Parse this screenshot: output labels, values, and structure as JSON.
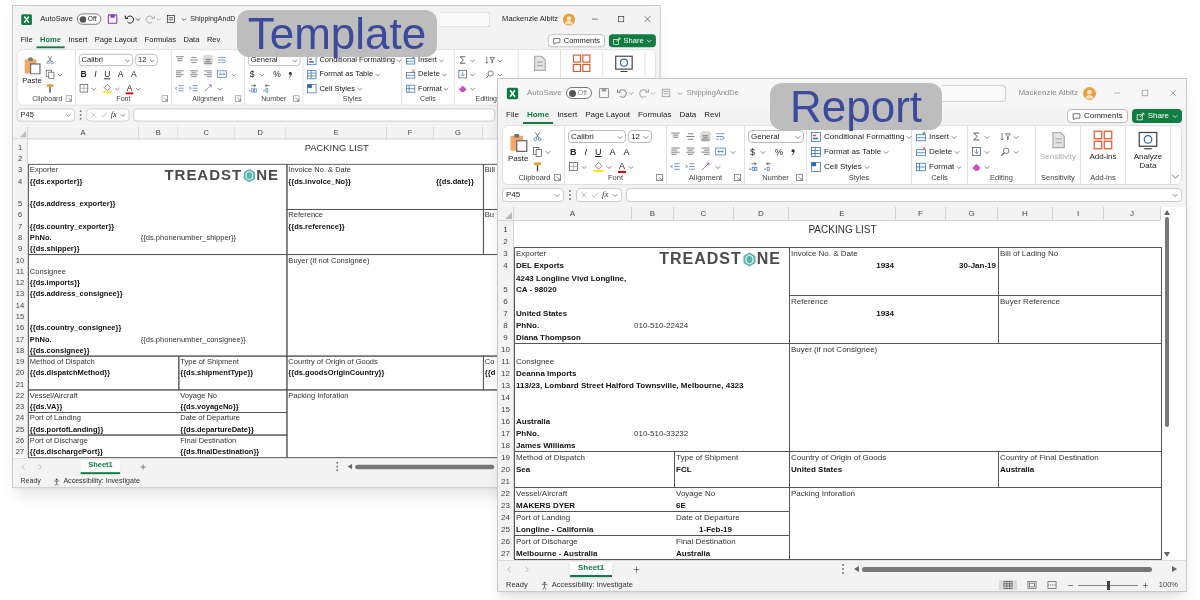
{
  "windows": [
    {
      "badge": "Template",
      "active": true,
      "title_bar": {
        "autosave": {
          "label": "AutoSave",
          "on": false,
          "state": "Off"
        },
        "filename": "ShippingAndD",
        "user": "Mackenzie Albitz"
      },
      "menu": [
        {
          "label": "File",
          "selected": false
        },
        {
          "label": "Home",
          "selected": true
        },
        {
          "label": "Insert",
          "selected": false
        },
        {
          "label": "Page Layout",
          "selected": false
        },
        {
          "label": "Formulas",
          "selected": false
        },
        {
          "label": "Data",
          "selected": false
        },
        {
          "label": "Rev",
          "selected": false
        }
      ],
      "comments": "Comments",
      "share": "Share",
      "ribbon": {
        "paste": "Paste",
        "font": "Calibri",
        "size": "12",
        "font_glyphs": [
          "B",
          "I",
          "U",
          "A",
          "A"
        ],
        "font_color": "A",
        "number_format": "General",
        "number_glyphs": [
          "$",
          "%"
        ],
        "styles": [
          "Conditional Formatting",
          "Format as Table",
          "Cell Styles"
        ],
        "cells": [
          "Insert",
          "Delete",
          "Format"
        ],
        "groups": [
          "Clipboard",
          "Font",
          "Alignment",
          "Number",
          "Styles",
          "Cells",
          "Editing"
        ],
        "extra": [
          {
            "kind": "sensitivity",
            "disabled": true
          },
          {
            "kind": "addins"
          },
          {
            "kind": "analyze"
          }
        ]
      },
      "name_box": "P45",
      "fx": "fx",
      "columns": [
        "A",
        "B",
        "C",
        "D",
        "E",
        "F",
        "G"
      ],
      "sheet": [
        {
          "row": "1",
          "cells": {
            "E": {
              "text": "PACKING LIST",
              "centered": true
            }
          }
        },
        {
          "row": "2"
        },
        {
          "row": "3",
          "logo": {
            "parts": [
              "TREADST",
              "NE"
            ]
          },
          "cells": {
            "A": {
              "text": "Exporter"
            },
            "E": {
              "text": "Invoice No. & Date"
            },
            "H": {
              "text": "Bill"
            }
          }
        },
        {
          "row": "4",
          "cells": {
            "A": {
              "text": "{{ds.exporter}}",
              "bold": true
            },
            "E": {
              "text": "{{ds.invoice_No}}",
              "bold": true
            },
            "G": {
              "text": "{{ds.date}}",
              "bold": true
            }
          }
        },
        {
          "row": "5",
          "cells": {
            "A": {
              "text": "{{ds.address_exporter}}",
              "bold": true
            }
          }
        },
        {
          "row": "6",
          "cells": {
            "E": {
              "text": "Reference"
            },
            "H": {
              "text": "Bu"
            }
          }
        },
        {
          "row": "7",
          "cells": {
            "A": {
              "text": "{{ds.country_exporter}}",
              "bold": true
            },
            "E": {
              "text": "{{ds.reference}}",
              "bold": true
            }
          }
        },
        {
          "row": "8",
          "cells": {
            "A": {
              "text": "PhNo.",
              "bold": true
            },
            "B": {
              "text": "{{ds.phonenumber_shipper}}"
            }
          }
        },
        {
          "row": "9",
          "cells": {
            "A": {
              "text": "{{ds.shipper}}",
              "bold": true
            }
          }
        },
        {
          "row": "10",
          "cells": {
            "E": {
              "text": "Buyer (if not Consignee)"
            }
          }
        },
        {
          "row": "11",
          "cells": {
            "A": {
              "text": "Consignee"
            }
          }
        },
        {
          "row": "12",
          "cells": {
            "A": {
              "text": "{{ds.imports}}",
              "bold": true
            }
          }
        },
        {
          "row": "13",
          "cells": {
            "A": {
              "text": "{{ds.address_consignee}}",
              "bold": true
            }
          }
        },
        {
          "row": "14"
        },
        {
          "row": "15"
        },
        {
          "row": "16",
          "cells": {
            "A": {
              "text": "{{ds.country_consignee}}",
              "bold": true
            }
          }
        },
        {
          "row": "17",
          "cells": {
            "A": {
              "text": "PhNo.",
              "bold": true
            },
            "B": {
              "text": "{{ds.phonenumber_consignee}}"
            }
          }
        },
        {
          "row": "18",
          "cells": {
            "A": {
              "text": "{{ds.consignee}}",
              "bold": true
            }
          }
        },
        {
          "row": "19",
          "cells": {
            "A": {
              "text": "Method of Dispatch"
            },
            "C": {
              "text": "Type of Shipment"
            },
            "E": {
              "text": "Country of Origin of Goods"
            },
            "H": {
              "text": "Co"
            }
          }
        },
        {
          "row": "20",
          "cells": {
            "A": {
              "text": "{{ds.dispatchMethod}}",
              "bold": true
            },
            "C": {
              "text": "{{ds.shipmentType}}",
              "bold": true
            },
            "E": {
              "text": "{{ds.goodsOriginCountry}}",
              "bold": true
            },
            "H": {
              "text": "{{d",
              "bold": true
            }
          }
        },
        {
          "row": "21"
        },
        {
          "row": "22",
          "cells": {
            "A": {
              "text": "Vessel/Aircraft"
            },
            "C": {
              "text": "Voyage No"
            },
            "E": {
              "text": "Packing Inforation"
            }
          }
        },
        {
          "row": "23",
          "cells": {
            "A": {
              "text": "{{ds.VA}}",
              "bold": true
            },
            "C": {
              "text": "{{ds.voyageNo}}",
              "bold": true
            }
          }
        },
        {
          "row": "24",
          "cells": {
            "A": {
              "text": "Port of Landing"
            },
            "C": {
              "text": "Date of Departure"
            }
          }
        },
        {
          "row": "25",
          "cells": {
            "A": {
              "text": "{{ds.portofLanding}}",
              "bold": true
            },
            "C": {
              "text": "{{ds.departureDate}}",
              "bold": true
            }
          }
        },
        {
          "row": "26",
          "cells": {
            "A": {
              "text": "Port of Discharge"
            },
            "C": {
              "text": "Final Destination"
            }
          }
        },
        {
          "row": "27",
          "cells": {
            "A": {
              "text": "{{ds.dischargePort}}",
              "bold": true
            },
            "C": {
              "text": "{{ds.finalDestination}}",
              "bold": true
            }
          }
        }
      ],
      "sheet_tabs": [
        {
          "label": "Sheet1",
          "selected": true
        }
      ],
      "status": "Ready",
      "accessibility": "Accessibility: Investigate"
    },
    {
      "badge": "Report",
      "active": false,
      "title_bar": {
        "autosave": {
          "label": "AutoSave",
          "on": false,
          "state": "Off"
        },
        "filename": "ShippingAndDe",
        "user": "Mackenzie Albitz"
      },
      "menu": [
        {
          "label": "File",
          "selected": false
        },
        {
          "label": "Home",
          "selected": true
        },
        {
          "label": "Insert",
          "selected": false
        },
        {
          "label": "Page Layout",
          "selected": false
        },
        {
          "label": "Formulas",
          "selected": false
        },
        {
          "label": "Data",
          "selected": false
        },
        {
          "label": "Revi",
          "selected": false
        }
      ],
      "comments": "Comments",
      "share": "Share",
      "ribbon": {
        "paste": "Paste",
        "font": "Calibri",
        "size": "12",
        "font_glyphs": [
          "B",
          "I",
          "U",
          "A",
          "A"
        ],
        "font_color": "A",
        "number_format": "General",
        "number_glyphs": [
          "$",
          "%"
        ],
        "styles": [
          "Conditional Formatting",
          "Format as Table",
          "Cell Styles"
        ],
        "cells": [
          "Insert",
          "Delete",
          "Format"
        ],
        "groups": [
          "Clipboard",
          "Font",
          "Alignment",
          "Number",
          "Styles",
          "Cells",
          "Editing"
        ],
        "extra": [
          {
            "kind": "sensitivity",
            "label": "Sensitivity",
            "group": "Sensitivity",
            "disabled": true
          },
          {
            "kind": "addins",
            "label": "Add-ins",
            "group": "Add-ins"
          },
          {
            "kind": "analyze",
            "label": "Analyze Data"
          }
        ]
      },
      "name_box": "P45",
      "fx": "fx",
      "columns": [
        "A",
        "B",
        "C",
        "D",
        "E",
        "F",
        "G",
        "H",
        "I",
        "J"
      ],
      "sheet": [
        {
          "row": "1",
          "cells": {
            "E": {
              "text": "PACKING LIST",
              "centered": true
            }
          }
        },
        {
          "row": "2"
        },
        {
          "row": "3",
          "logo": {
            "parts": [
              "TREADST",
              "NE"
            ]
          },
          "cells": {
            "A": {
              "text": "Exporter"
            },
            "E": {
              "text": "Invoice No. & Date"
            },
            "H": {
              "text": "Bill of Lading No"
            }
          }
        },
        {
          "row": "4",
          "cells": {
            "A": {
              "text": "DEL Exports",
              "bold": true
            },
            "E": {
              "text": "1934",
              "bold": true,
              "right_aligned": true
            },
            "G": {
              "text": "30-Jan-19",
              "bold": true,
              "right_aligned": true
            }
          }
        },
        {
          "row": "5",
          "cells": {
            "A": {
              "text": "4243 Longline Vlvd Longline,\nCA - 98020",
              "bold": true
            }
          }
        },
        {
          "row": "6",
          "cells": {
            "E": {
              "text": "Reference"
            },
            "H": {
              "text": "Buyer Reference"
            }
          }
        },
        {
          "row": "7",
          "cells": {
            "A": {
              "text": "United States",
              "bold": true
            },
            "E": {
              "text": "1934",
              "bold": true,
              "right_aligned": true
            }
          }
        },
        {
          "row": "8",
          "cells": {
            "A": {
              "text": "PhNo.",
              "bold": true
            },
            "B": {
              "text": "010-510-22424"
            }
          }
        },
        {
          "row": "9",
          "cells": {
            "A": {
              "text": "Diana Thompson",
              "bold": true
            }
          }
        },
        {
          "row": "10",
          "cells": {
            "E": {
              "text": "Buyer (if not Consignee)"
            }
          }
        },
        {
          "row": "11",
          "cells": {
            "A": {
              "text": "Consignee"
            }
          }
        },
        {
          "row": "12",
          "cells": {
            "A": {
              "text": "Deanna Imports",
              "bold": true
            }
          }
        },
        {
          "row": "13",
          "cells": {
            "A": {
              "text": "113/23, Lombard Street Halford Townsville, Melbourne, 4323",
              "bold": true
            }
          }
        },
        {
          "row": "14"
        },
        {
          "row": "15"
        },
        {
          "row": "16",
          "cells": {
            "A": {
              "text": "Australia",
              "bold": true
            }
          }
        },
        {
          "row": "17",
          "cells": {
            "A": {
              "text": "PhNo.",
              "bold": true
            },
            "B": {
              "text": "010-510-33232"
            }
          }
        },
        {
          "row": "18",
          "cells": {
            "A": {
              "text": "James Williams",
              "bold": true
            }
          }
        },
        {
          "row": "19",
          "cells": {
            "A": {
              "text": "Method of Dispatch"
            },
            "C": {
              "text": "Type of Shipment"
            },
            "E": {
              "text": "Country of Origin of Goods"
            },
            "H": {
              "text": "Country of Final Destination"
            }
          }
        },
        {
          "row": "20",
          "cells": {
            "A": {
              "text": "Sea",
              "bold": true
            },
            "C": {
              "text": "FCL",
              "bold": true
            },
            "E": {
              "text": "United States",
              "bold": true
            },
            "H": {
              "text": "Australia",
              "bold": true
            }
          }
        },
        {
          "row": "21"
        },
        {
          "row": "22",
          "cells": {
            "A": {
              "text": "Vessel/Aircraft"
            },
            "C": {
              "text": "Voyage No"
            },
            "E": {
              "text": "Packing Inforation"
            }
          }
        },
        {
          "row": "23",
          "cells": {
            "A": {
              "text": "MAKERS DYER",
              "bold": true
            },
            "C": {
              "text": "6E",
              "bold": true
            }
          }
        },
        {
          "row": "24",
          "cells": {
            "A": {
              "text": "Port of Landing"
            },
            "C": {
              "text": "Date of Departure"
            }
          }
        },
        {
          "row": "25",
          "cells": {
            "A": {
              "text": "Longline - California",
              "bold": true
            },
            "C": {
              "text": "1-Feb-19",
              "bold": true,
              "right_aligned": true
            }
          }
        },
        {
          "row": "26",
          "cells": {
            "A": {
              "text": "Port of Discharge"
            },
            "C": {
              "text": "Final Destination"
            }
          }
        },
        {
          "row": "27",
          "cells": {
            "A": {
              "text": "Melbourne - Australia",
              "bold": true
            },
            "C": {
              "text": "Australia",
              "bold": true
            }
          }
        }
      ],
      "sheet_tabs": [
        {
          "label": "Sheet1",
          "selected": true
        }
      ],
      "status": "Ready",
      "accessibility": "Accessibility: Investigate",
      "zoom": {
        "level": 0.5,
        "reading": "100%"
      }
    }
  ]
}
